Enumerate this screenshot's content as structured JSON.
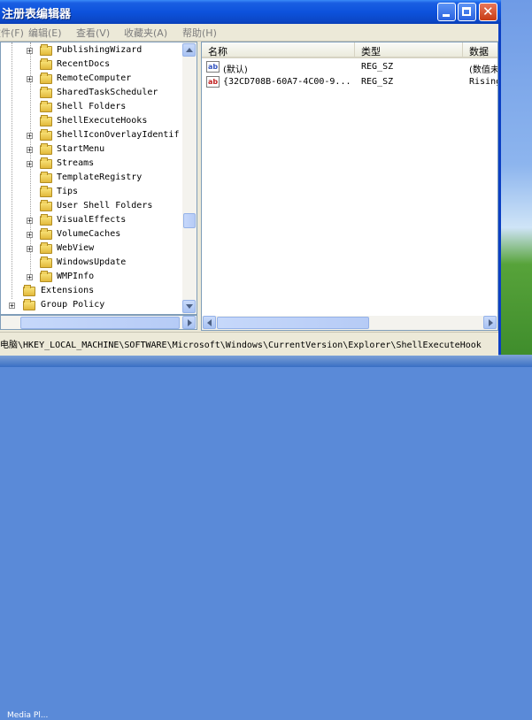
{
  "window": {
    "title": "注册表编辑器"
  },
  "menu": [
    "文件(F)",
    "编辑(E)",
    "查看(V)",
    "收藏夹(A)",
    "帮助(H)"
  ],
  "tree": {
    "items": [
      {
        "label": "PublishingWizard",
        "expander": "+"
      },
      {
        "label": "RecentDocs",
        "expander": ""
      },
      {
        "label": "RemoteComputer",
        "expander": "+"
      },
      {
        "label": "SharedTaskScheduler",
        "expander": ""
      },
      {
        "label": "Shell Folders",
        "expander": ""
      },
      {
        "label": "ShellExecuteHooks",
        "expander": ""
      },
      {
        "label": "ShellIconOverlayIdentif",
        "expander": "+"
      },
      {
        "label": "StartMenu",
        "expander": "+"
      },
      {
        "label": "Streams",
        "expander": "+"
      },
      {
        "label": "TemplateRegistry",
        "expander": ""
      },
      {
        "label": "Tips",
        "expander": ""
      },
      {
        "label": "User Shell Folders",
        "expander": ""
      },
      {
        "label": "VisualEffects",
        "expander": "+"
      },
      {
        "label": "VolumeCaches",
        "expander": "+"
      },
      {
        "label": "WebView",
        "expander": "+"
      },
      {
        "label": "WindowsUpdate",
        "expander": ""
      },
      {
        "label": "WMPInfo",
        "expander": "+"
      },
      {
        "label": "Extensions",
        "expander": ""
      },
      {
        "label": "Group Policy",
        "expander": "+"
      }
    ]
  },
  "list": {
    "columns": [
      "名称",
      "类型",
      "数据"
    ],
    "rows": [
      {
        "icon": "ab",
        "name": "(默认)",
        "type": "REG_SZ",
        "data": "(数值未"
      },
      {
        "icon": "ab",
        "name": "{32CD708B-60A7-4C00-9...",
        "type": "REG_SZ",
        "data": "Rising"
      }
    ]
  },
  "statusbar": {
    "path": "电脑\\HKEY_LOCAL_MACHINE\\SOFTWARE\\Microsoft\\Windows\\CurrentVersion\\Explorer\\ShellExecuteHook"
  },
  "taskbar": {
    "text": "Media Pl..."
  },
  "colors": {
    "titlebar": "#0d52dc",
    "window_bg": "#ece9d8"
  }
}
